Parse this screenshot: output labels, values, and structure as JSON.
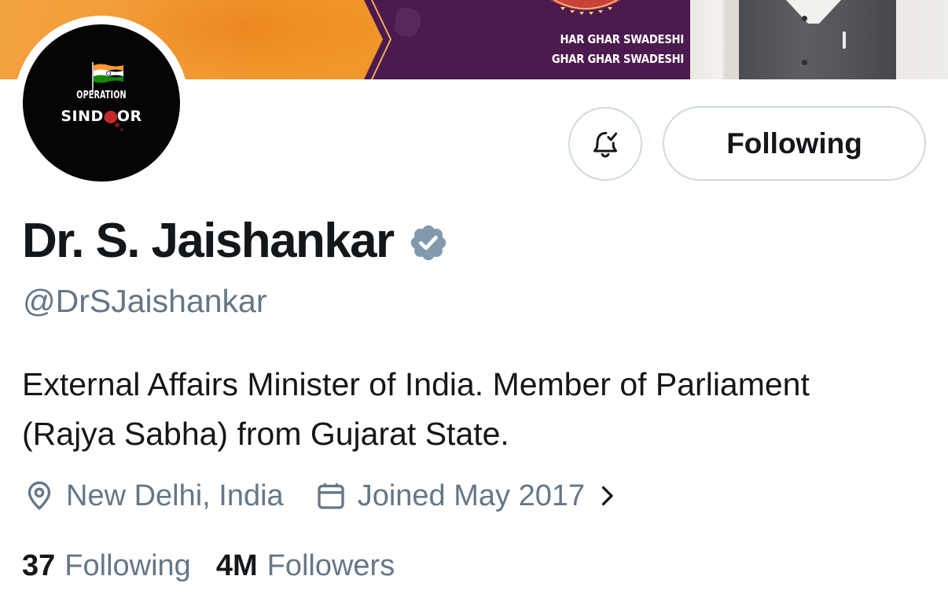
{
  "banner": {
    "line1": "HAR GHAR SWADESHI",
    "line2": "GHAR GHAR SWADESHI"
  },
  "avatar": {
    "line1": "OPERATION",
    "line2": "SIND●OR"
  },
  "actions": {
    "notify_icon": "bell-check-icon",
    "follow_label": "Following"
  },
  "profile": {
    "display_name": "Dr. S. Jaishankar",
    "verified_icon": "verified-badge-icon",
    "handle": "@DrSJaishankar",
    "bio": "External Affairs Minister of India. Member of Parliament (Rajya Sabha) from Gujarat State.",
    "location": "New Delhi, India",
    "joined": "Joined May 2017"
  },
  "stats": {
    "following_count": "37",
    "following_label": "Following",
    "followers_count": "4M",
    "followers_label": "Followers"
  },
  "colors": {
    "text_primary": "#14171a",
    "text_secondary": "#657786",
    "border": "#cfd9de",
    "banner_orange": "#f39a2e",
    "banner_purple": "#4b1a4e"
  }
}
